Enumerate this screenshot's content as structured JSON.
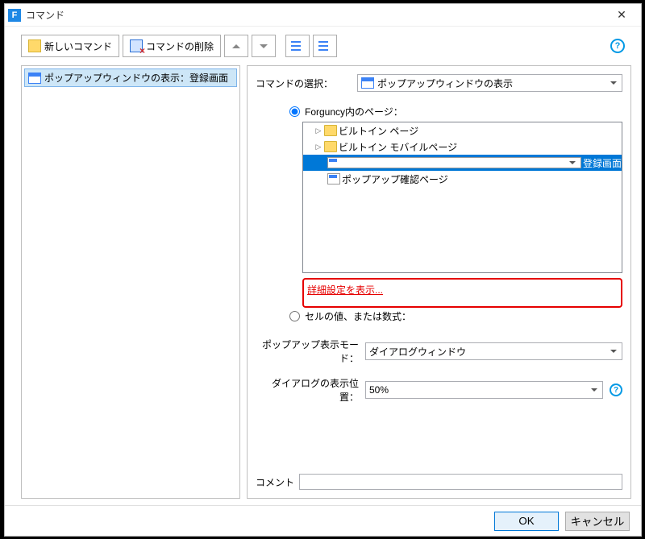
{
  "window": {
    "title": "コマンド",
    "app_icon_letter": "F"
  },
  "toolbar": {
    "new_command": "新しいコマンド",
    "delete_command": "コマンドの削除"
  },
  "left": {
    "item_label": "ポップアップウィンドウの表示：登録画面"
  },
  "right": {
    "command_select_label": "コマンドの選択：",
    "command_select_value": "ポップアップウィンドウの表示",
    "radio_page_label": "Forguncy内のページ：",
    "tree": {
      "builtin_page": "ビルトイン ページ",
      "builtin_mobile": "ビルトイン モバイルページ",
      "selected_page": "登録画面",
      "popup_confirm": "ポップアップ確認ページ"
    },
    "detail_link": "詳細設定を表示...",
    "radio_cell_label": "セルの値、または数式：",
    "popup_mode_label": "ポップアップ表示モード：",
    "popup_mode_value": "ダイアログウィンドウ",
    "dialog_pos_label": "ダイアログの表示位置：",
    "dialog_pos_value": "50%",
    "comment_label": "コメント",
    "comment_value": ""
  },
  "footer": {
    "ok": "OK",
    "cancel": "キャンセル"
  }
}
